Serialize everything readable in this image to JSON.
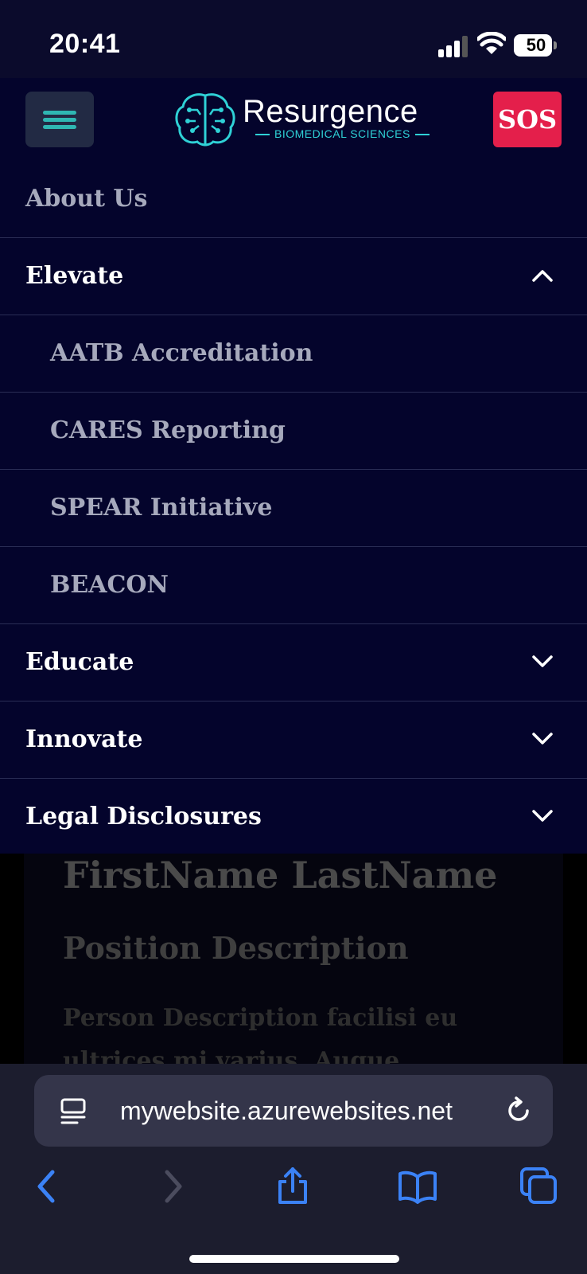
{
  "status_bar": {
    "time": "20:41",
    "battery": "50"
  },
  "header": {
    "logo_name": "Resurgence",
    "logo_subtitle": "BIOMEDICAL SCIENCES",
    "sos_label": "SOS"
  },
  "menu": {
    "about": "About Us",
    "elevate": "Elevate",
    "elevate_items": [
      "AATB Accreditation",
      "CARES Reporting",
      "SPEAR Initiative",
      "BEACON"
    ],
    "educate": "Educate",
    "innovate": "Innovate",
    "legal": "Legal Disclosures"
  },
  "page": {
    "name": "FirstName LastName",
    "position": "Position Description",
    "description": "Person Description facilisi eu ultrices mi varius. Augue posuere"
  },
  "browser": {
    "url": "mywebsite.azurewebsites.net"
  },
  "colors": {
    "background": "#04042c",
    "accent": "#2fb7b3",
    "sos": "#e41f4b",
    "safari_blue": "#3b82f6"
  }
}
